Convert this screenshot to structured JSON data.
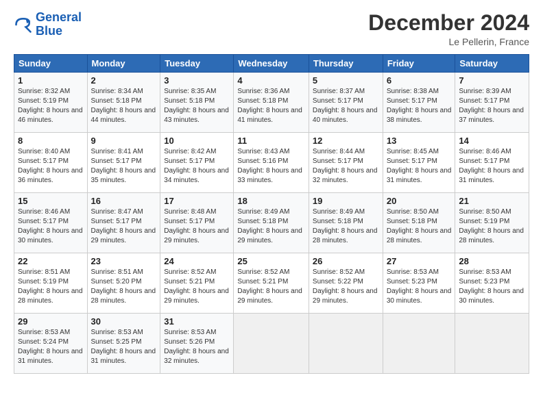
{
  "logo": {
    "line1": "General",
    "line2": "Blue"
  },
  "title": "December 2024",
  "subtitle": "Le Pellerin, France",
  "header_days": [
    "Sunday",
    "Monday",
    "Tuesday",
    "Wednesday",
    "Thursday",
    "Friday",
    "Saturday"
  ],
  "weeks": [
    [
      {
        "day": "1",
        "sunrise": "8:32 AM",
        "sunset": "5:19 PM",
        "daylight": "8 hours and 46 minutes."
      },
      {
        "day": "2",
        "sunrise": "8:34 AM",
        "sunset": "5:18 PM",
        "daylight": "8 hours and 44 minutes."
      },
      {
        "day": "3",
        "sunrise": "8:35 AM",
        "sunset": "5:18 PM",
        "daylight": "8 hours and 43 minutes."
      },
      {
        "day": "4",
        "sunrise": "8:36 AM",
        "sunset": "5:18 PM",
        "daylight": "8 hours and 41 minutes."
      },
      {
        "day": "5",
        "sunrise": "8:37 AM",
        "sunset": "5:17 PM",
        "daylight": "8 hours and 40 minutes."
      },
      {
        "day": "6",
        "sunrise": "8:38 AM",
        "sunset": "5:17 PM",
        "daylight": "8 hours and 38 minutes."
      },
      {
        "day": "7",
        "sunrise": "8:39 AM",
        "sunset": "5:17 PM",
        "daylight": "8 hours and 37 minutes."
      }
    ],
    [
      {
        "day": "8",
        "sunrise": "8:40 AM",
        "sunset": "5:17 PM",
        "daylight": "8 hours and 36 minutes."
      },
      {
        "day": "9",
        "sunrise": "8:41 AM",
        "sunset": "5:17 PM",
        "daylight": "8 hours and 35 minutes."
      },
      {
        "day": "10",
        "sunrise": "8:42 AM",
        "sunset": "5:17 PM",
        "daylight": "8 hours and 34 minutes."
      },
      {
        "day": "11",
        "sunrise": "8:43 AM",
        "sunset": "5:16 PM",
        "daylight": "8 hours and 33 minutes."
      },
      {
        "day": "12",
        "sunrise": "8:44 AM",
        "sunset": "5:17 PM",
        "daylight": "8 hours and 32 minutes."
      },
      {
        "day": "13",
        "sunrise": "8:45 AM",
        "sunset": "5:17 PM",
        "daylight": "8 hours and 31 minutes."
      },
      {
        "day": "14",
        "sunrise": "8:46 AM",
        "sunset": "5:17 PM",
        "daylight": "8 hours and 31 minutes."
      }
    ],
    [
      {
        "day": "15",
        "sunrise": "8:46 AM",
        "sunset": "5:17 PM",
        "daylight": "8 hours and 30 minutes."
      },
      {
        "day": "16",
        "sunrise": "8:47 AM",
        "sunset": "5:17 PM",
        "daylight": "8 hours and 29 minutes."
      },
      {
        "day": "17",
        "sunrise": "8:48 AM",
        "sunset": "5:17 PM",
        "daylight": "8 hours and 29 minutes."
      },
      {
        "day": "18",
        "sunrise": "8:49 AM",
        "sunset": "5:18 PM",
        "daylight": "8 hours and 29 minutes."
      },
      {
        "day": "19",
        "sunrise": "8:49 AM",
        "sunset": "5:18 PM",
        "daylight": "8 hours and 28 minutes."
      },
      {
        "day": "20",
        "sunrise": "8:50 AM",
        "sunset": "5:18 PM",
        "daylight": "8 hours and 28 minutes."
      },
      {
        "day": "21",
        "sunrise": "8:50 AM",
        "sunset": "5:19 PM",
        "daylight": "8 hours and 28 minutes."
      }
    ],
    [
      {
        "day": "22",
        "sunrise": "8:51 AM",
        "sunset": "5:19 PM",
        "daylight": "8 hours and 28 minutes."
      },
      {
        "day": "23",
        "sunrise": "8:51 AM",
        "sunset": "5:20 PM",
        "daylight": "8 hours and 28 minutes."
      },
      {
        "day": "24",
        "sunrise": "8:52 AM",
        "sunset": "5:21 PM",
        "daylight": "8 hours and 29 minutes."
      },
      {
        "day": "25",
        "sunrise": "8:52 AM",
        "sunset": "5:21 PM",
        "daylight": "8 hours and 29 minutes."
      },
      {
        "day": "26",
        "sunrise": "8:52 AM",
        "sunset": "5:22 PM",
        "daylight": "8 hours and 29 minutes."
      },
      {
        "day": "27",
        "sunrise": "8:53 AM",
        "sunset": "5:23 PM",
        "daylight": "8 hours and 30 minutes."
      },
      {
        "day": "28",
        "sunrise": "8:53 AM",
        "sunset": "5:23 PM",
        "daylight": "8 hours and 30 minutes."
      }
    ],
    [
      {
        "day": "29",
        "sunrise": "8:53 AM",
        "sunset": "5:24 PM",
        "daylight": "8 hours and 31 minutes."
      },
      {
        "day": "30",
        "sunrise": "8:53 AM",
        "sunset": "5:25 PM",
        "daylight": "8 hours and 31 minutes."
      },
      {
        "day": "31",
        "sunrise": "8:53 AM",
        "sunset": "5:26 PM",
        "daylight": "8 hours and 32 minutes."
      },
      null,
      null,
      null,
      null
    ]
  ]
}
